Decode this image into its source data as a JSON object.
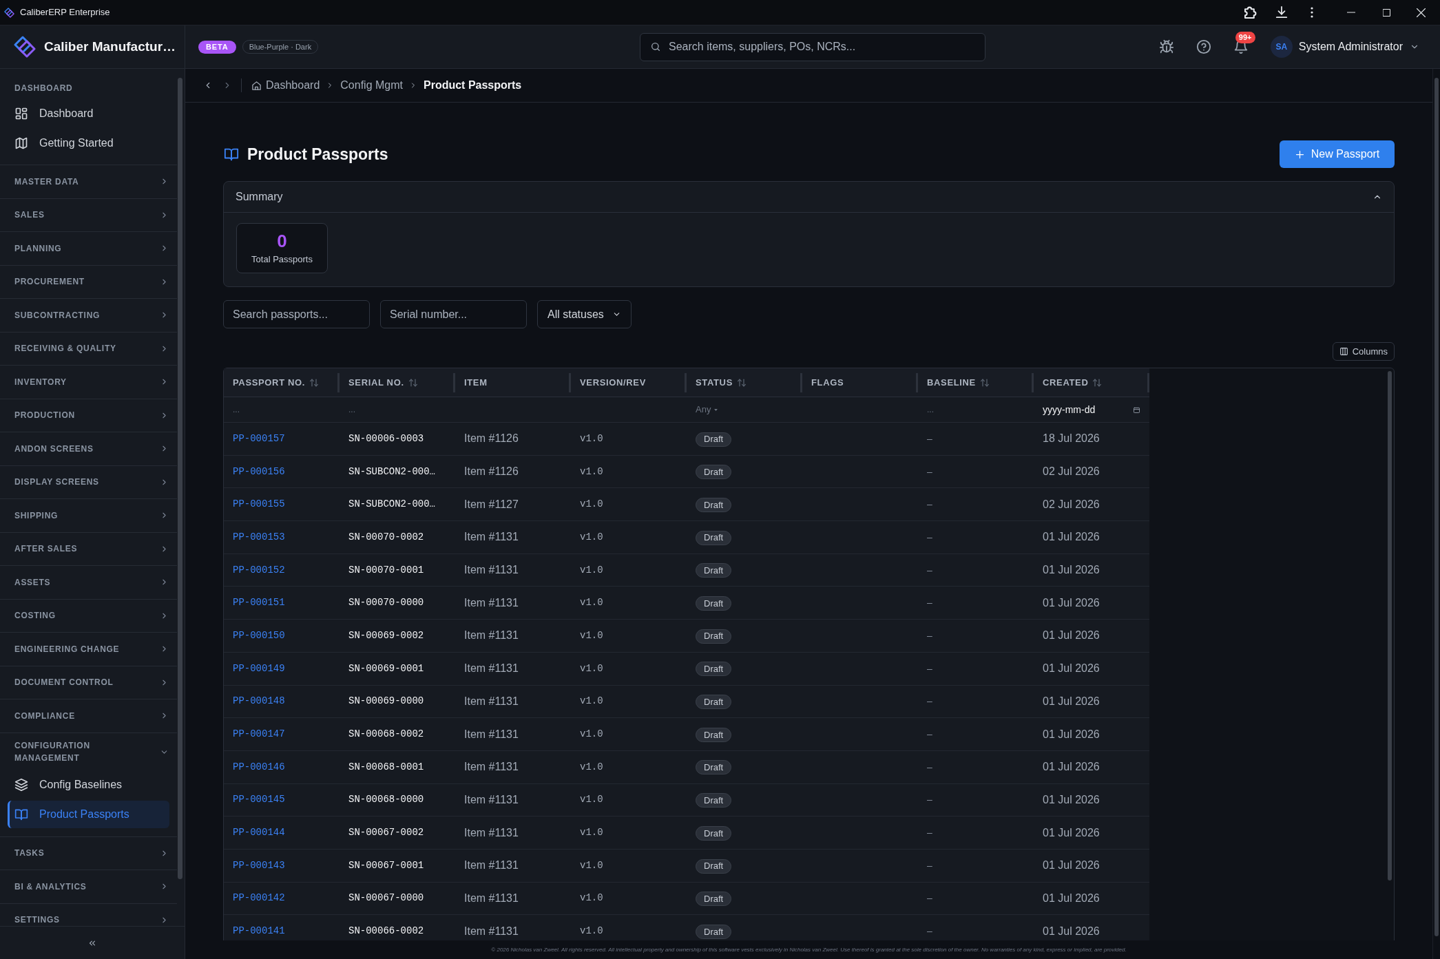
{
  "window": {
    "title": "CaliberERP Enterprise"
  },
  "header": {
    "app_name": "Caliber Manufactur…",
    "badge": "BETA",
    "theme": "Blue-Purple · Dark",
    "search": {
      "placeholder": "Search items, suppliers, POs, NCRs..."
    },
    "notification_count": "99+",
    "user": {
      "initials": "SA",
      "name": "System Administrator"
    }
  },
  "sidebar": {
    "dashboard_section": {
      "label": "DASHBOARD",
      "items": [
        {
          "label": "Dashboard",
          "selected": false
        },
        {
          "label": "Getting Started",
          "selected": false
        }
      ]
    },
    "groups": [
      {
        "label": "MASTER DATA",
        "expanded": false
      },
      {
        "label": "SALES",
        "expanded": false
      },
      {
        "label": "PLANNING",
        "expanded": false
      },
      {
        "label": "PROCUREMENT",
        "expanded": false
      },
      {
        "label": "SUBCONTRACTING",
        "expanded": false
      },
      {
        "label": "RECEIVING & QUALITY",
        "expanded": false
      },
      {
        "label": "INVENTORY",
        "expanded": false
      },
      {
        "label": "PRODUCTION",
        "expanded": false
      },
      {
        "label": "ANDON SCREENS",
        "expanded": false
      },
      {
        "label": "DISPLAY SCREENS",
        "expanded": false
      },
      {
        "label": "SHIPPING",
        "expanded": false
      },
      {
        "label": "AFTER SALES",
        "expanded": false
      },
      {
        "label": "ASSETS",
        "expanded": false
      },
      {
        "label": "COSTING",
        "expanded": false
      },
      {
        "label": "ENGINEERING CHANGE",
        "expanded": false
      },
      {
        "label": "DOCUMENT CONTROL",
        "expanded": false
      },
      {
        "label": "COMPLIANCE",
        "expanded": false
      },
      {
        "label": "CONFIGURATION MANAGEMENT",
        "expanded": true,
        "children": [
          {
            "label": "Config Baselines",
            "selected": false
          },
          {
            "label": "Product Passports",
            "selected": true
          }
        ]
      },
      {
        "label": "TASKS",
        "expanded": false
      },
      {
        "label": "BI & ANALYTICS",
        "expanded": false
      },
      {
        "label": "SETTINGS",
        "expanded": false
      }
    ]
  },
  "breadcrumb": [
    {
      "label": "Dashboard",
      "current": false
    },
    {
      "label": "Config Mgmt",
      "current": false
    },
    {
      "label": "Product Passports",
      "current": true
    }
  ],
  "page": {
    "title": "Product Passports",
    "new_button": "New Passport"
  },
  "summary": {
    "title": "Summary",
    "expanded": true,
    "cards": [
      {
        "value": "0",
        "label": "Total Passports"
      }
    ]
  },
  "filters": {
    "search": {
      "placeholder": "Search passports..."
    },
    "serial": {
      "placeholder": "Serial number..."
    },
    "status": {
      "value": "All statuses"
    }
  },
  "columns_button": "Columns",
  "table": {
    "columns": [
      {
        "label": "PASSPORT NO.",
        "sortable": true,
        "filter": {
          "kind": "text",
          "placeholder": "..."
        }
      },
      {
        "label": "SERIAL NO.",
        "sortable": true,
        "filter": {
          "kind": "text",
          "placeholder": "..."
        }
      },
      {
        "label": "ITEM",
        "sortable": false
      },
      {
        "label": "VERSION/REV",
        "sortable": false
      },
      {
        "label": "STATUS",
        "sortable": true,
        "filter": {
          "kind": "select",
          "value": "Any"
        }
      },
      {
        "label": "FLAGS",
        "sortable": false
      },
      {
        "label": "BASELINE",
        "sortable": true,
        "filter": {
          "kind": "text",
          "placeholder": "..."
        }
      },
      {
        "label": "CREATED",
        "sortable": true,
        "filter": {
          "kind": "date",
          "placeholder": "yyyy-mm-dd"
        }
      }
    ],
    "rows": [
      {
        "passport_no": "PP-000157",
        "serial_no": "SN-00006-0003",
        "item": "Item #1126",
        "version": "v1.0",
        "status": "Draft",
        "baseline": "–",
        "created": "18 Jul 2026"
      },
      {
        "passport_no": "PP-000156",
        "serial_no": "SN-SUBCON2-000…",
        "item": "Item #1126",
        "version": "v1.0",
        "status": "Draft",
        "baseline": "–",
        "created": "02 Jul 2026"
      },
      {
        "passport_no": "PP-000155",
        "serial_no": "SN-SUBCON2-000…",
        "item": "Item #1127",
        "version": "v1.0",
        "status": "Draft",
        "baseline": "–",
        "created": "02 Jul 2026"
      },
      {
        "passport_no": "PP-000153",
        "serial_no": "SN-00070-0002",
        "item": "Item #1131",
        "version": "v1.0",
        "status": "Draft",
        "baseline": "–",
        "created": "01 Jul 2026"
      },
      {
        "passport_no": "PP-000152",
        "serial_no": "SN-00070-0001",
        "item": "Item #1131",
        "version": "v1.0",
        "status": "Draft",
        "baseline": "–",
        "created": "01 Jul 2026"
      },
      {
        "passport_no": "PP-000151",
        "serial_no": "SN-00070-0000",
        "item": "Item #1131",
        "version": "v1.0",
        "status": "Draft",
        "baseline": "–",
        "created": "01 Jul 2026"
      },
      {
        "passport_no": "PP-000150",
        "serial_no": "SN-00069-0002",
        "item": "Item #1131",
        "version": "v1.0",
        "status": "Draft",
        "baseline": "–",
        "created": "01 Jul 2026"
      },
      {
        "passport_no": "PP-000149",
        "serial_no": "SN-00069-0001",
        "item": "Item #1131",
        "version": "v1.0",
        "status": "Draft",
        "baseline": "–",
        "created": "01 Jul 2026"
      },
      {
        "passport_no": "PP-000148",
        "serial_no": "SN-00069-0000",
        "item": "Item #1131",
        "version": "v1.0",
        "status": "Draft",
        "baseline": "–",
        "created": "01 Jul 2026"
      },
      {
        "passport_no": "PP-000147",
        "serial_no": "SN-00068-0002",
        "item": "Item #1131",
        "version": "v1.0",
        "status": "Draft",
        "baseline": "–",
        "created": "01 Jul 2026"
      },
      {
        "passport_no": "PP-000146",
        "serial_no": "SN-00068-0001",
        "item": "Item #1131",
        "version": "v1.0",
        "status": "Draft",
        "baseline": "–",
        "created": "01 Jul 2026"
      },
      {
        "passport_no": "PP-000145",
        "serial_no": "SN-00068-0000",
        "item": "Item #1131",
        "version": "v1.0",
        "status": "Draft",
        "baseline": "–",
        "created": "01 Jul 2026"
      },
      {
        "passport_no": "PP-000144",
        "serial_no": "SN-00067-0002",
        "item": "Item #1131",
        "version": "v1.0",
        "status": "Draft",
        "baseline": "–",
        "created": "01 Jul 2026"
      },
      {
        "passport_no": "PP-000143",
        "serial_no": "SN-00067-0001",
        "item": "Item #1131",
        "version": "v1.0",
        "status": "Draft",
        "baseline": "–",
        "created": "01 Jul 2026"
      },
      {
        "passport_no": "PP-000142",
        "serial_no": "SN-00067-0000",
        "item": "Item #1131",
        "version": "v1.0",
        "status": "Draft",
        "baseline": "–",
        "created": "01 Jul 2026"
      },
      {
        "passport_no": "PP-000141",
        "serial_no": "SN-00066-0002",
        "item": "Item #1131",
        "version": "v1.0",
        "status": "Draft",
        "baseline": "–",
        "created": "01 Jul 2026"
      }
    ]
  },
  "footer": "© 2026 Nicholas van Zweel. All rights reserved. All intellectual property and ownership of this software vests exclusively in Nicholas van Zweel. Use thereof is granted at the sole discretion of the owner. No warranties of any kind, express or implied, are provided."
}
